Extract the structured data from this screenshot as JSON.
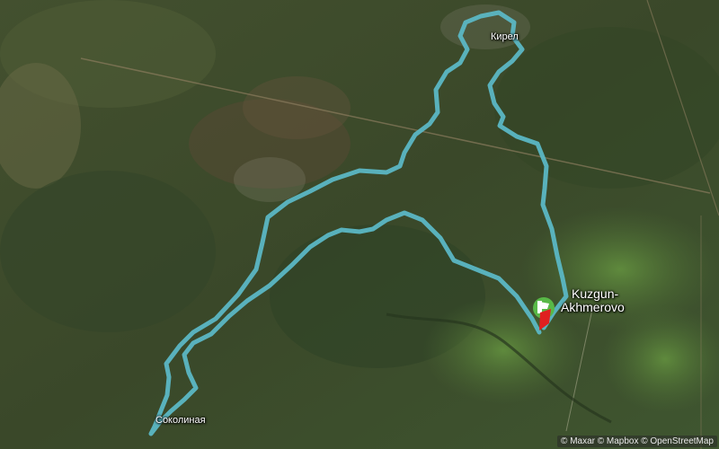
{
  "map": {
    "type": "satellite",
    "route_color": "#5bb7c4",
    "places": {
      "kirel": "Кирел",
      "sokolinaya": "Соколиная",
      "kuzgun_line1": "Kuzgun-",
      "kuzgun_line2": "Akhmerovo"
    },
    "markers": {
      "start": "green-flag-icon",
      "finish": "red-flag-icon"
    },
    "attribution": "© Maxar © Mapbox © OpenStreetMap"
  }
}
